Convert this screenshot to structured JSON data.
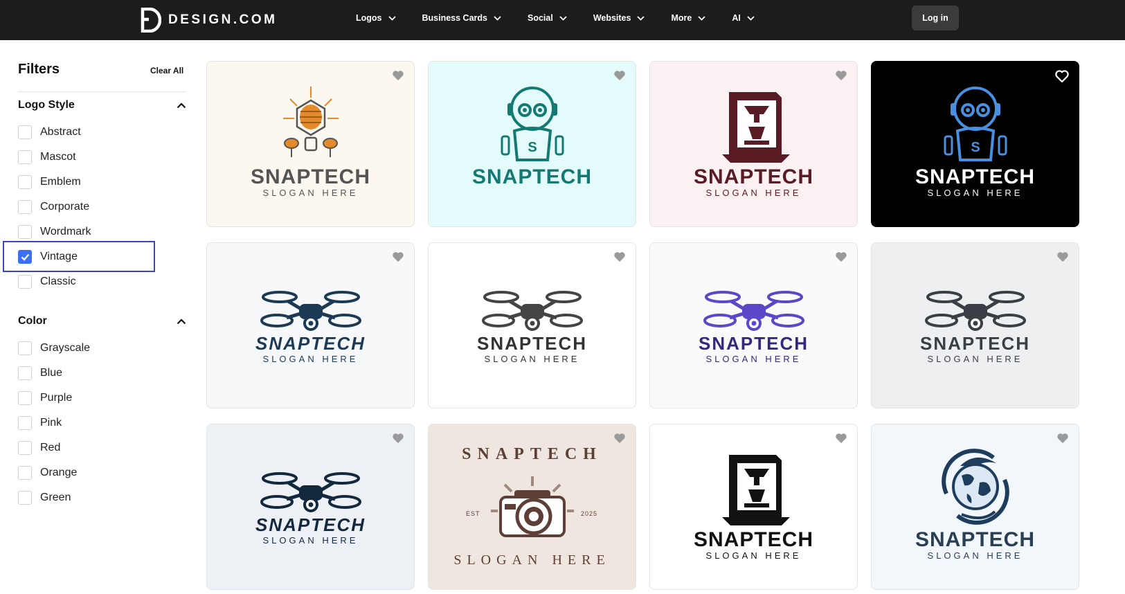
{
  "header": {
    "brand": "DESIGN.COM",
    "nav": [
      "Logos",
      "Business Cards",
      "Social",
      "Websites",
      "More",
      "AI"
    ],
    "login_label": "Log in"
  },
  "sidebar": {
    "title": "Filters",
    "clear_all": "Clear All",
    "sections": [
      {
        "label": "Logo Style",
        "options": [
          {
            "label": "Abstract",
            "checked": false
          },
          {
            "label": "Mascot",
            "checked": false
          },
          {
            "label": "Emblem",
            "checked": false
          },
          {
            "label": "Corporate",
            "checked": false
          },
          {
            "label": "Wordmark",
            "checked": false
          },
          {
            "label": "Vintage",
            "checked": true
          },
          {
            "label": "Classic",
            "checked": false
          }
        ]
      },
      {
        "label": "Color",
        "options": [
          {
            "label": "Grayscale",
            "checked": false
          },
          {
            "label": "Blue",
            "checked": false
          },
          {
            "label": "Purple",
            "checked": false
          },
          {
            "label": "Pink",
            "checked": false
          },
          {
            "label": "Red",
            "checked": false
          },
          {
            "label": "Orange",
            "checked": false
          },
          {
            "label": "Green",
            "checked": false
          }
        ]
      }
    ]
  },
  "cards": [
    {
      "title": "SNAPTECH",
      "slogan": "SLOGAN HERE",
      "bg": "#fdf8ef",
      "fg": "#555555",
      "accent": "#e58a2a",
      "icon": "lightbulb-icon"
    },
    {
      "title": "SNAPTECH",
      "slogan": "",
      "bg": "#e3fbfb",
      "fg": "#127a72",
      "accent": "#127a72",
      "icon": "robot-icon"
    },
    {
      "title": "SNAPTECH",
      "slogan": "SLOGAN HERE",
      "bg": "#fbf1f3",
      "fg": "#5a1c24",
      "accent": "#5a1c24",
      "icon": "3d-printer-icon"
    },
    {
      "title": "SNAPTECH",
      "slogan": "SLOGAN HERE",
      "bg": "#000000",
      "fg": "#ffffff",
      "accent": "#4a8fe0",
      "icon": "robot-icon"
    },
    {
      "title": "SNAPTECH",
      "slogan": "SLOGAN HERE",
      "bg": "#f7f8fa",
      "fg": "#1d3a55",
      "accent": "#1d3a55",
      "icon": "drone-icon"
    },
    {
      "title": "SNAPTECH",
      "slogan": "SLOGAN HERE",
      "bg": "#ffffff",
      "fg": "#333333",
      "accent": "#444444",
      "icon": "drone-icon"
    },
    {
      "title": "SNAPTECH",
      "slogan": "SLOGAN HERE",
      "bg": "#fafafa",
      "fg": "#34287a",
      "accent": "#5a48c8",
      "icon": "drone-icon"
    },
    {
      "title": "SNAPTECH",
      "slogan": "SLOGAN HERE",
      "bg": "#eeeff1",
      "fg": "#3a3f45",
      "accent": "#3a3f45",
      "icon": "drone-icon"
    },
    {
      "title": "SNAPTECH",
      "slogan": "SLOGAN HERE",
      "bg": "#edf1f5",
      "fg": "#12293d",
      "accent": "#12293d",
      "icon": "drone-icon"
    },
    {
      "title": "SNAPTECH",
      "slogan": "SLOGAN HERE",
      "bg": "#efe7df",
      "fg": "#5e3f37",
      "accent": "#5e3f37",
      "icon": "camera-icon",
      "est": "EST",
      "year": "2025"
    },
    {
      "title": "SNAPTECH",
      "slogan": "SLOGAN HERE",
      "bg": "#ffffff",
      "fg": "#111111",
      "accent": "#111111",
      "icon": "3d-printer-icon"
    },
    {
      "title": "SNAPTECH",
      "slogan": "SLOGAN HERE",
      "bg": "#f2f7fb",
      "fg": "#2b3f52",
      "accent": "#1e3c5c",
      "icon": "globe-icon"
    }
  ]
}
